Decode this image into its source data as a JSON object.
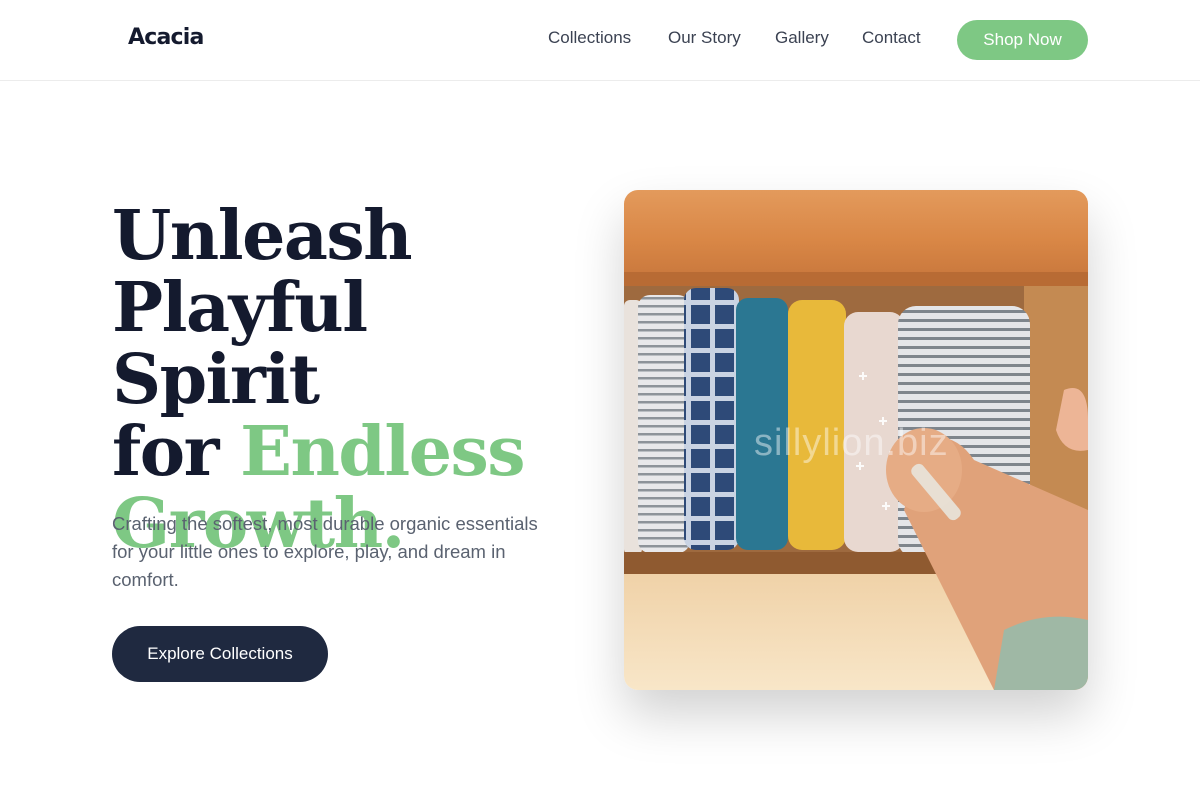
{
  "brand": {
    "name": "Acacia"
  },
  "nav": {
    "links": [
      {
        "label": "Collections"
      },
      {
        "label": "Our Story"
      },
      {
        "label": "Gallery"
      },
      {
        "label": "Contact"
      }
    ],
    "cta": "Shop Now"
  },
  "hero": {
    "title_line1": "Unleash",
    "title_line2": "Playful Spirit",
    "title_line3_prefix": "for ",
    "title_line3_accent": "Endless",
    "title_line4_accent": "Growth.",
    "subtitle": "Crafting the softest, most durable organic essentials for your little ones to explore, play, and dream in comfort.",
    "cta": "Explore Collections",
    "image_watermark": "sillylion.biz"
  },
  "colors": {
    "accent": "#7ec884",
    "dark": "#1f2940",
    "heading": "#141a2e"
  }
}
